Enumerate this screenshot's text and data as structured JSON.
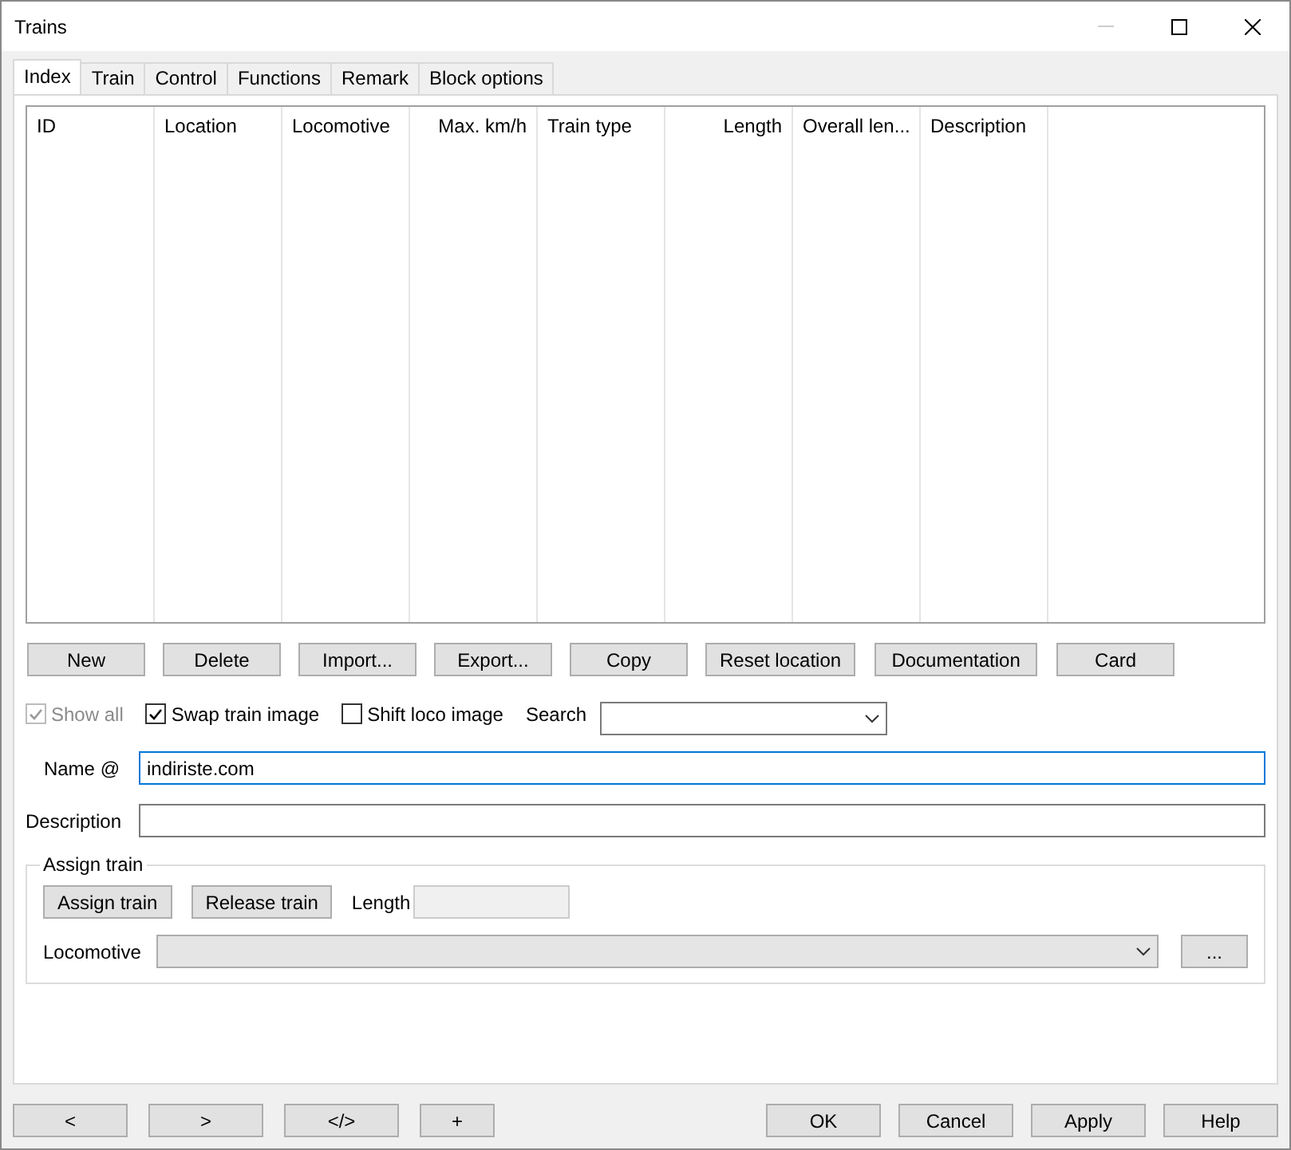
{
  "window": {
    "title": "Trains"
  },
  "tabs": [
    {
      "label": "Index",
      "selected": true
    },
    {
      "label": "Train",
      "selected": false
    },
    {
      "label": "Control",
      "selected": false
    },
    {
      "label": "Functions",
      "selected": false
    },
    {
      "label": "Remark",
      "selected": false
    },
    {
      "label": "Block options",
      "selected": false
    }
  ],
  "table": {
    "columns": [
      {
        "label": "ID"
      },
      {
        "label": "Location"
      },
      {
        "label": "Locomotive"
      },
      {
        "label": "Max. km/h"
      },
      {
        "label": "Train type"
      },
      {
        "label": "Length"
      },
      {
        "label": "Overall len..."
      },
      {
        "label": "Description"
      }
    ]
  },
  "actions": [
    "New",
    "Delete",
    "Import...",
    "Export...",
    "Copy",
    "Reset location",
    "Documentation",
    "Card"
  ],
  "options": [
    {
      "label": "Show all",
      "checked": true,
      "disabled": true
    },
    {
      "label": "Swap train image",
      "checked": true,
      "disabled": false
    },
    {
      "label": "Shift loco image",
      "checked": false,
      "disabled": false
    }
  ],
  "search": {
    "label": "Search"
  },
  "name": {
    "label": "Name @",
    "value": "indiriste.com"
  },
  "description": {
    "label": "Description"
  },
  "assign_group": {
    "title": "Assign train",
    "buttons": [
      "Assign train",
      "Release train"
    ],
    "length_label": "Length",
    "locomotive_label": "Locomotive",
    "more_button": "..."
  },
  "nav_buttons": [
    "<",
    ">",
    "</>",
    "+"
  ],
  "dialog_buttons": [
    "OK",
    "Cancel",
    "Apply",
    "Help"
  ]
}
